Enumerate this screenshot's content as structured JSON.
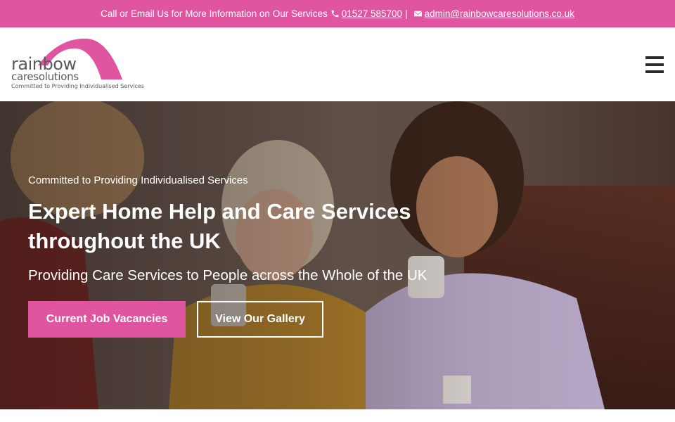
{
  "colors": {
    "brand_pink": "#e0559f",
    "header_bg": "#ffffff",
    "hero_text": "#ffffff"
  },
  "topbar": {
    "text": "Call or Email Us for More Information on Our Services",
    "phone_icon": "phone-icon",
    "phone": "01527 585700",
    "separator": "|",
    "email_icon": "envelope-icon",
    "email": "admin@rainbowcaresolutions.co.uk"
  },
  "header": {
    "logo": {
      "word1": "rainbow",
      "word2": "caresolutions",
      "tagline": "Committed to Providing Individualised Services"
    },
    "menu_icon": "hamburger-menu-icon"
  },
  "hero": {
    "kicker": "Committed to Providing Individualised Services",
    "title": "Expert Home Help and Care Services throughout the UK",
    "subtitle": "Providing Care Services to People across the Whole of the UK",
    "buttons": {
      "primary": "Current Job Vacancies",
      "secondary": "View Our Gallery"
    }
  }
}
